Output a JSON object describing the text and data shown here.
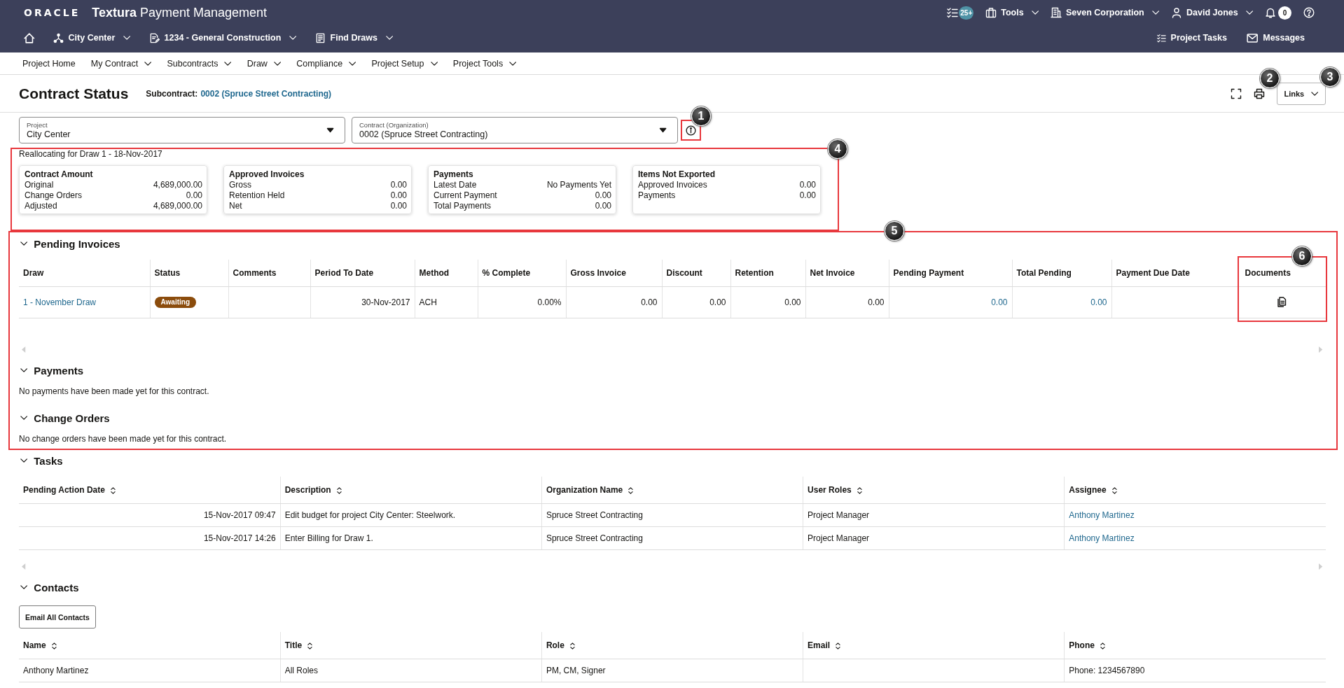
{
  "header": {
    "logo": "ORACLE",
    "app_title": "**Textura** Payment Management",
    "utilities": [
      {
        "kind": "tasks",
        "badge": "25+",
        "dropdown": false
      },
      {
        "kind": "tools",
        "label": "Tools",
        "dropdown": true
      },
      {
        "kind": "organization",
        "label": "Seven Corporation",
        "dropdown": true
      },
      {
        "kind": "user",
        "label": "David Jones",
        "dropdown": true
      },
      {
        "kind": "notifications",
        "badge": "0",
        "dropdown": false
      },
      {
        "kind": "help",
        "dropdown": false
      }
    ],
    "context": [
      {
        "kind": "home",
        "dropdown": false
      },
      {
        "kind": "project",
        "label": "City Center",
        "dropdown": true
      },
      {
        "kind": "contract",
        "label": "1234 - General Construction",
        "dropdown": true
      },
      {
        "kind": "draws",
        "label": "Find Draws",
        "dropdown": true
      }
    ],
    "shortcuts": [
      {
        "kind": "tasks",
        "label": "Project Tasks"
      },
      {
        "kind": "messages",
        "label": "Messages"
      }
    ]
  },
  "nav": [
    {
      "label": "Project Home",
      "dropdown": false
    },
    {
      "label": "My Contract",
      "dropdown": true
    },
    {
      "label": "Subcontracts",
      "dropdown": true
    },
    {
      "label": "Draw",
      "dropdown": true
    },
    {
      "label": "Compliance",
      "dropdown": true
    },
    {
      "label": "Project Setup",
      "dropdown": true
    },
    {
      "label": "Project Tools",
      "dropdown": true
    }
  ],
  "page": {
    "title": "Contract Status",
    "subcontract_label": "Subcontract:",
    "subcontract": "0002 (Spruce Street Contracting)",
    "tools": [
      {
        "kind": "fullscreen"
      },
      {
        "kind": "print",
        "callout": "2"
      }
    ],
    "links_button": {
      "label": "Links",
      "dropdown": true,
      "callout": "3"
    }
  },
  "filters": {
    "fields": [
      {
        "label": "Project",
        "value": "City Center"
      },
      {
        "label": "Contract (Organization)",
        "value": "0002 (Spruce Street Contracting)"
      }
    ],
    "info_button": {
      "callout": "1",
      "highlighted": true
    }
  },
  "summary": {
    "callout": "4",
    "highlighted": true,
    "caption": "Reallocating for Draw 1 - 18-Nov-2017",
    "cards": [
      {
        "title": "Contract Amount",
        "rows": [
          {
            "label": "Original",
            "value": "4,689,000.00"
          },
          {
            "label": "Change Orders",
            "value": "0.00"
          },
          {
            "label": "Adjusted",
            "value": "4,689,000.00"
          }
        ]
      },
      {
        "title": "Approved Invoices",
        "rows": [
          {
            "label": "Gross",
            "value": "0.00"
          },
          {
            "label": "Retention Held",
            "value": "0.00"
          },
          {
            "label": "Net",
            "value": "0.00"
          }
        ]
      },
      {
        "title": "Payments",
        "rows": [
          {
            "label": "Latest Date",
            "value": "No Payments Yet"
          },
          {
            "label": "Current Payment",
            "value": "0.00"
          },
          {
            "label": "Total Payments",
            "value": "0.00"
          }
        ]
      },
      {
        "title": "Items Not Exported",
        "rows": [
          {
            "label": "Approved Invoices",
            "value": "0.00"
          },
          {
            "label": "Payments",
            "value": "0.00"
          }
        ]
      }
    ]
  },
  "status_sections": {
    "callout": "5",
    "highlighted": true,
    "sections": [
      {
        "kind": "table",
        "title": "Pending Invoices",
        "expanded": true,
        "scrollable": true,
        "columns": [
          {
            "label": "Draw",
            "kind": "text"
          },
          {
            "label": "Status",
            "kind": "text"
          },
          {
            "label": "Comments",
            "kind": "text"
          },
          {
            "label": "Period To Date",
            "kind": "date"
          },
          {
            "label": "Method",
            "kind": "text"
          },
          {
            "label": "% Complete",
            "kind": "number"
          },
          {
            "label": "Gross Invoice",
            "kind": "number"
          },
          {
            "label": "Discount",
            "kind": "number"
          },
          {
            "label": "Retention",
            "kind": "number"
          },
          {
            "label": "Net Invoice",
            "kind": "number"
          },
          {
            "label": "Pending Payment",
            "kind": "number"
          },
          {
            "label": "Total Pending",
            "kind": "number"
          },
          {
            "label": "Payment Due Date",
            "kind": "date"
          },
          {
            "label": "Documents",
            "kind": "icon",
            "callout": "6",
            "highlighted": true
          }
        ],
        "rows": [
          {
            "cells": [
              {
                "kind": "link",
                "text": "1 - November Draw"
              },
              {
                "kind": "badge",
                "text": "Awaiting"
              },
              {
                "kind": "empty"
              },
              {
                "kind": "text",
                "text": "30-Nov-2017"
              },
              {
                "kind": "text",
                "text": "ACH"
              },
              {
                "kind": "text",
                "text": "0.00%"
              },
              {
                "kind": "text",
                "text": "0.00"
              },
              {
                "kind": "text",
                "text": "0.00"
              },
              {
                "kind": "text",
                "text": "0.00"
              },
              {
                "kind": "text",
                "text": "0.00"
              },
              {
                "kind": "link",
                "text": "0.00"
              },
              {
                "kind": "link",
                "text": "0.00"
              },
              {
                "kind": "empty"
              },
              {
                "kind": "document_icon"
              }
            ]
          }
        ]
      },
      {
        "kind": "message",
        "title": "Payments",
        "expanded": true,
        "message": "No payments have been made yet for this contract."
      },
      {
        "kind": "message",
        "title": "Change Orders",
        "expanded": true,
        "message": "No change orders have been made yet for this contract."
      }
    ]
  },
  "tasks": {
    "kind": "table",
    "title": "Tasks",
    "expanded": true,
    "scrollable": true,
    "columns": [
      {
        "label": "Pending Action Date",
        "kind": "date",
        "sortable": true
      },
      {
        "label": "Description",
        "kind": "text",
        "sortable": true
      },
      {
        "label": "Organization Name",
        "kind": "text",
        "sortable": true
      },
      {
        "label": "User Roles",
        "kind": "text",
        "sortable": true
      },
      {
        "label": "Assignee",
        "kind": "text",
        "sortable": true
      }
    ],
    "rows": [
      {
        "cells": [
          {
            "kind": "text",
            "text": "15-Nov-2017 09:47"
          },
          {
            "kind": "text",
            "text": "Edit budget for project City Center: Steelwork."
          },
          {
            "kind": "text",
            "text": "Spruce Street Contracting"
          },
          {
            "kind": "text",
            "text": "Project Manager"
          },
          {
            "kind": "link",
            "text": "Anthony Martinez"
          }
        ]
      },
      {
        "cells": [
          {
            "kind": "text",
            "text": "15-Nov-2017 14:26"
          },
          {
            "kind": "text",
            "text": "Enter Billing for Draw 1."
          },
          {
            "kind": "text",
            "text": "Spruce Street Contracting"
          },
          {
            "kind": "text",
            "text": "Project Manager"
          },
          {
            "kind": "link",
            "text": "Anthony Martinez"
          }
        ]
      }
    ]
  },
  "contacts": {
    "kind": "table",
    "title": "Contacts",
    "expanded": true,
    "button": "Email All Contacts",
    "columns": [
      {
        "label": "Name",
        "kind": "text",
        "sortable": true
      },
      {
        "label": "Title",
        "kind": "text",
        "sortable": true
      },
      {
        "label": "Role",
        "kind": "text",
        "sortable": true
      },
      {
        "label": "Email",
        "kind": "text",
        "sortable": true
      },
      {
        "label": "Phone",
        "kind": "text",
        "sortable": true
      }
    ],
    "rows": [
      {
        "cells": [
          {
            "kind": "text",
            "text": "Anthony Martinez"
          },
          {
            "kind": "text",
            "text": "All Roles"
          },
          {
            "kind": "text",
            "text": "PM, CM, Signer"
          },
          {
            "kind": "empty"
          },
          {
            "kind": "text",
            "text": "Phone: 1234567890"
          }
        ]
      }
    ]
  }
}
